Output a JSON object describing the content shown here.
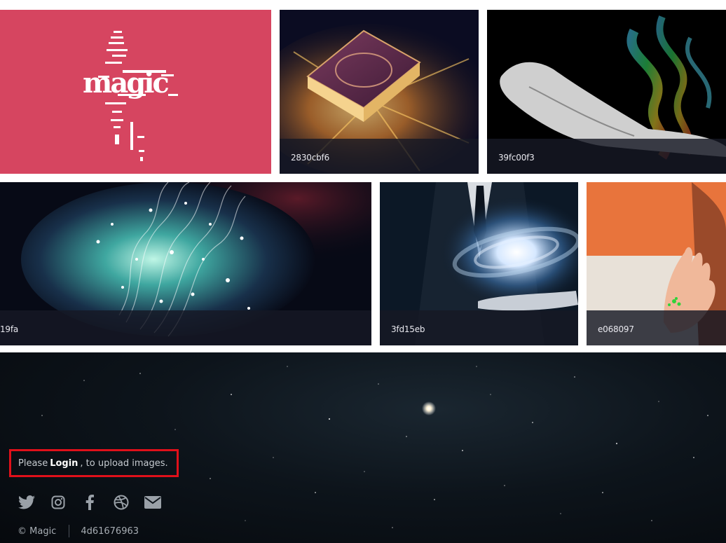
{
  "gallery": {
    "tiles": [
      {
        "id": "magic-logo",
        "caption": "",
        "bg": "#d64560"
      },
      {
        "id": "book",
        "caption": "2830cbf6"
      },
      {
        "id": "hand-smoke",
        "caption": "39fc00f3"
      },
      {
        "id": "particles",
        "caption": "19fa"
      },
      {
        "id": "suit-galaxy",
        "caption": "3fd15eb"
      },
      {
        "id": "hand-orange",
        "caption": "e068097"
      }
    ]
  },
  "footer": {
    "login_prefix": "Please",
    "login_link": "Login",
    "login_suffix": ", to upload images.",
    "social_icons": [
      "twitter-icon",
      "instagram-icon",
      "facebook-icon",
      "dribbble-icon",
      "mail-icon"
    ],
    "copyright": "© Magic",
    "build_id": "4d61676963",
    "accent_color": "#e0101a"
  }
}
